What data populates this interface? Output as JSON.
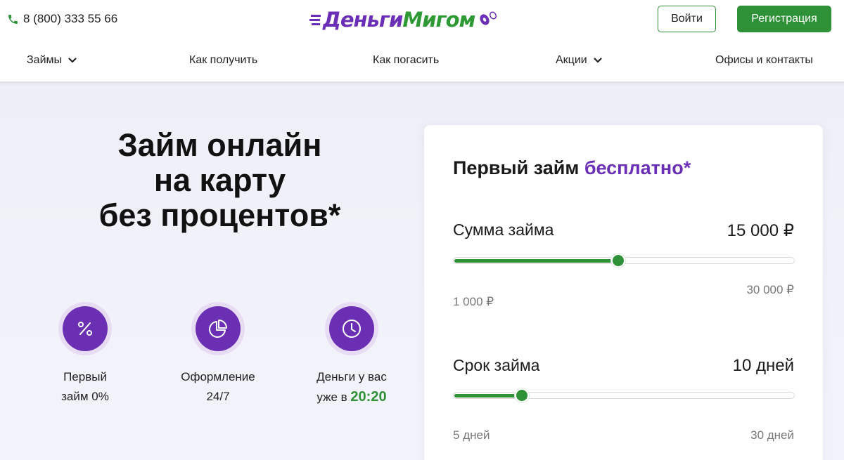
{
  "header": {
    "phone": "8 (800) 333 55 66",
    "logo_part1": "Деньги",
    "logo_part2": "Мигом",
    "login_label": "Войти",
    "register_label": "Регистрация"
  },
  "nav": {
    "items": [
      {
        "label": "Займы",
        "has_dropdown": true
      },
      {
        "label": "Как получить",
        "has_dropdown": false
      },
      {
        "label": "Как погасить",
        "has_dropdown": false
      },
      {
        "label": "Акции",
        "has_dropdown": true
      },
      {
        "label": "Офисы и контакты",
        "has_dropdown": false
      }
    ]
  },
  "hero": {
    "headline_line1": "Займ онлайн",
    "headline_line2": "на карту",
    "headline_line3": "без процентов*",
    "features": [
      {
        "icon": "percent-icon",
        "line1": "Первый",
        "line2": "займ 0%"
      },
      {
        "icon": "pie-chart-icon",
        "line1": "Оформление",
        "line2": "24/7"
      },
      {
        "icon": "clock-icon",
        "line1": "Деньги у вас",
        "line2_prefix": "уже в ",
        "line2_accent": "20:20"
      }
    ]
  },
  "calculator": {
    "title_main": "Первый займ ",
    "title_accent": "бесплатно",
    "title_suffix": "*",
    "amount": {
      "label": "Сумма займа",
      "value": "15 000 ₽",
      "min_label": "1 000 ₽",
      "max_label": "30 000 ₽",
      "min": 1000,
      "max": 30000,
      "current": 15000
    },
    "term": {
      "label": "Срок займа",
      "value": "10 дней",
      "min_label": "5 дней",
      "max_label": "30 дней",
      "min": 5,
      "max": 30,
      "current": 10
    }
  },
  "colors": {
    "brand_purple": "#6a2fb6",
    "brand_green": "#2e9137",
    "hero_bg": "#f1f2f9"
  }
}
